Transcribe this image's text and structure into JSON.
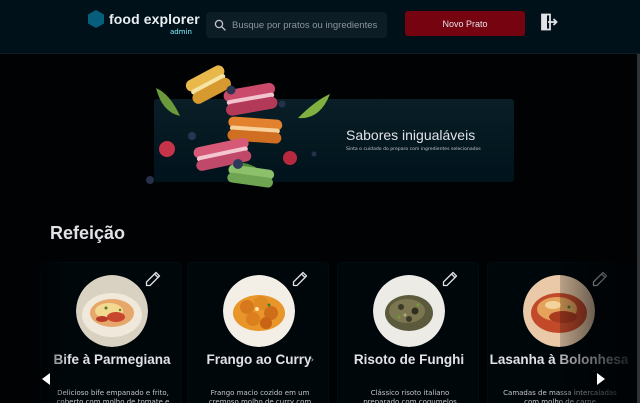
{
  "header": {
    "brand_name": "food explorer",
    "brand_role": "admin",
    "search_placeholder": "Busque por pratos ou ingredientes",
    "new_dish_label": "Novo Prato"
  },
  "banner": {
    "title": "Sabores inigualáveis",
    "subtitle": "Sinta o cuidado do preparo com ingredientes selecionados"
  },
  "section": {
    "title": "Refeição"
  },
  "dishes": [
    {
      "name": "Bife à Parmegiana",
      "description": "Delicioso bife empanado e frito, coberto com molho de tomate e"
    },
    {
      "name": "Frango ao Curry",
      "description": "Frango macio cozido em um cremoso molho de curry com"
    },
    {
      "name": "Risoto de Funghi",
      "description": "Clássico risoto italiano preparado com cogumelos"
    },
    {
      "name": "Lasanha à Bolonhesa",
      "description": "Camadas de massa intercaladas com molho de carne"
    }
  ],
  "colors": {
    "accent": "#82f3ff",
    "brand": "#065e7c",
    "primary_button": "#750310",
    "header_bg": "#00111a"
  }
}
